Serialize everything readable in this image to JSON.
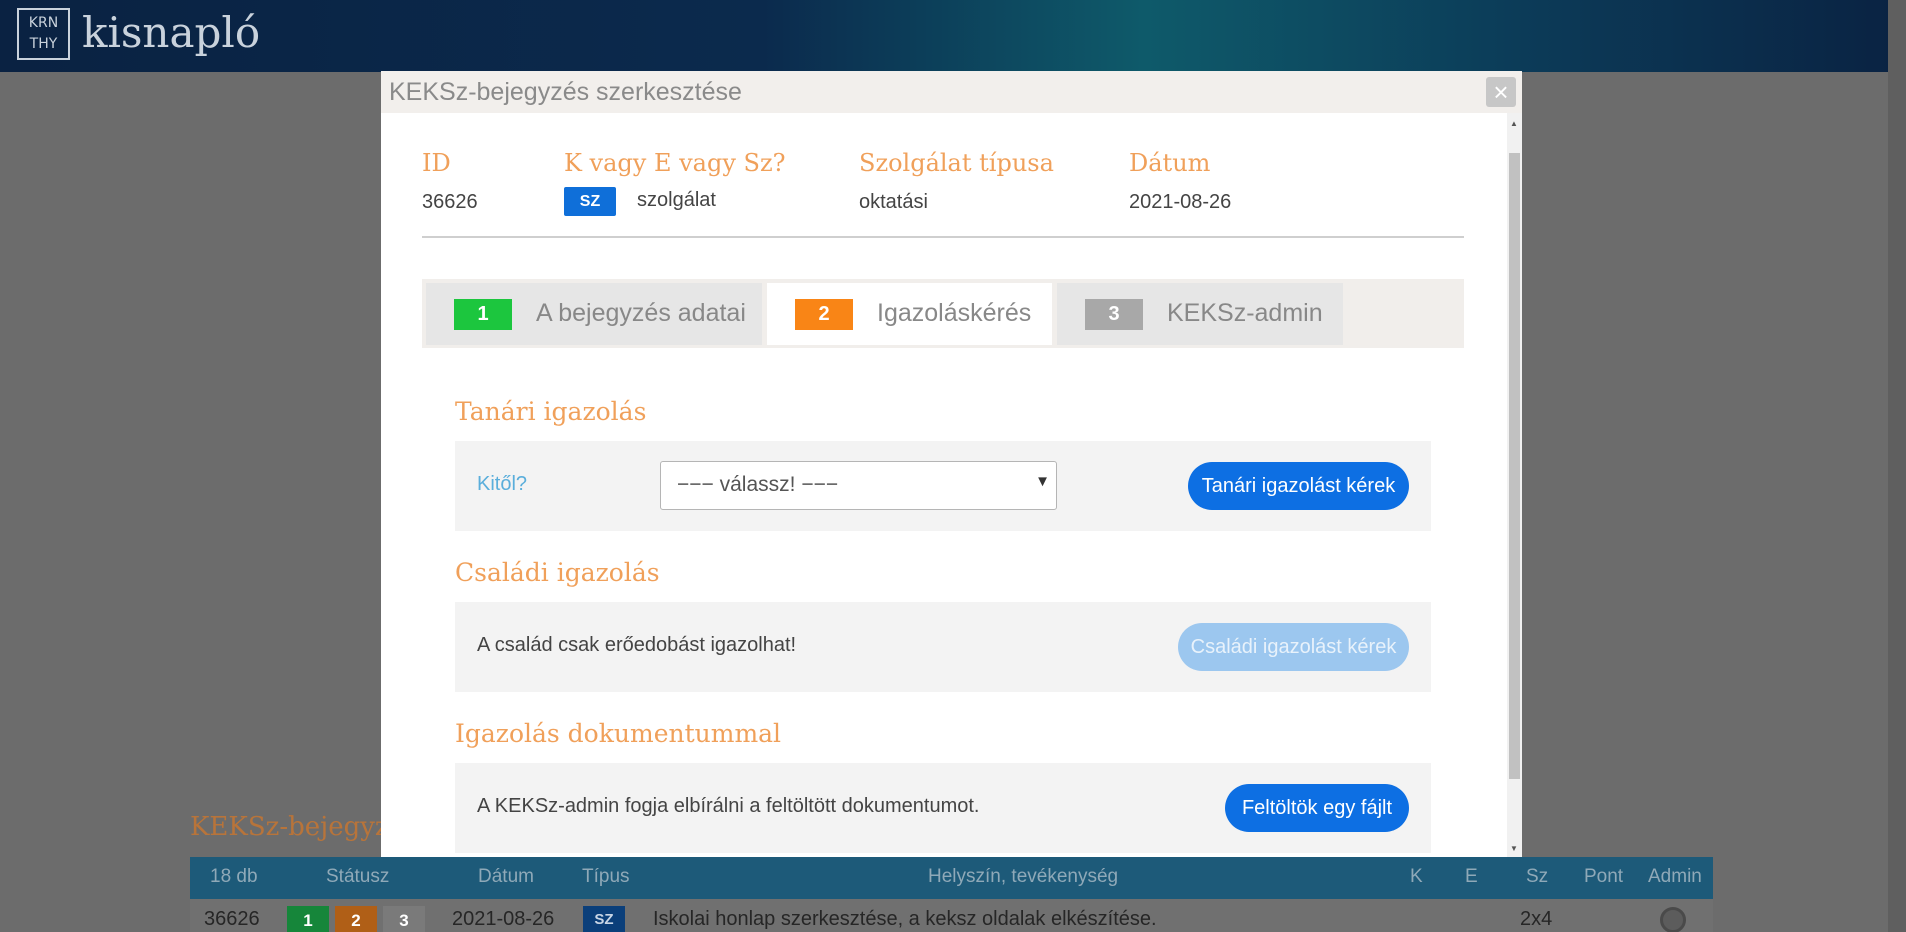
{
  "app": {
    "logo_line1": "KRN",
    "logo_line2": "THY",
    "name": "kisnapló"
  },
  "background": {
    "heading": "KEKSz-bejegyzé",
    "table": {
      "columns": [
        "18 db",
        "Státusz",
        "Dátum",
        "Típus",
        "Helyszín, tevékenység",
        "K",
        "E",
        "Sz",
        "Pont",
        "Admin"
      ],
      "row": {
        "id": "36626",
        "status": [
          "1",
          "2",
          "3"
        ],
        "date": "2021-08-26",
        "type": "SZ",
        "activity": "Iskolai honlap szerkesztése, a keksz oldalak elkészítése.",
        "sz": "2x4"
      }
    }
  },
  "modal": {
    "title": "KEKSz-bejegyzés szerkesztése",
    "close": "×",
    "info": {
      "labels": {
        "id": "ID",
        "kind": "K vagy E vagy Sz?",
        "service_type": "Szolgálat típusa",
        "date": "Dátum"
      },
      "values": {
        "id": "36626",
        "kind_badge": "SZ",
        "kind": "szolgálat",
        "service_type": "oktatási",
        "date": "2021-08-26"
      }
    },
    "tabs": [
      {
        "num": "1",
        "label": "A bejegyzés adatai",
        "color": "#1cc63e"
      },
      {
        "num": "2",
        "label": "Igazoláskérés",
        "color": "#f98516"
      },
      {
        "num": "3",
        "label": "KEKSz-admin",
        "color": "#a8a8a8"
      }
    ],
    "sections": {
      "teacher": {
        "title": "Tanári igazolás",
        "label": "Kitől?",
        "select_value": "−−− válassz! −−−",
        "button": "Tanári igazolást kérek"
      },
      "family": {
        "title": "Családi igazolás",
        "text": "A család csak erőedobást igazolhat!",
        "button": "Családi igazolást kérek"
      },
      "document": {
        "title": "Igazolás dokumentummal",
        "text": "A KEKSz-admin fogja elbírálni a feltöltött dokumentumot.",
        "button": "Feltöltök egy fájlt"
      }
    }
  }
}
